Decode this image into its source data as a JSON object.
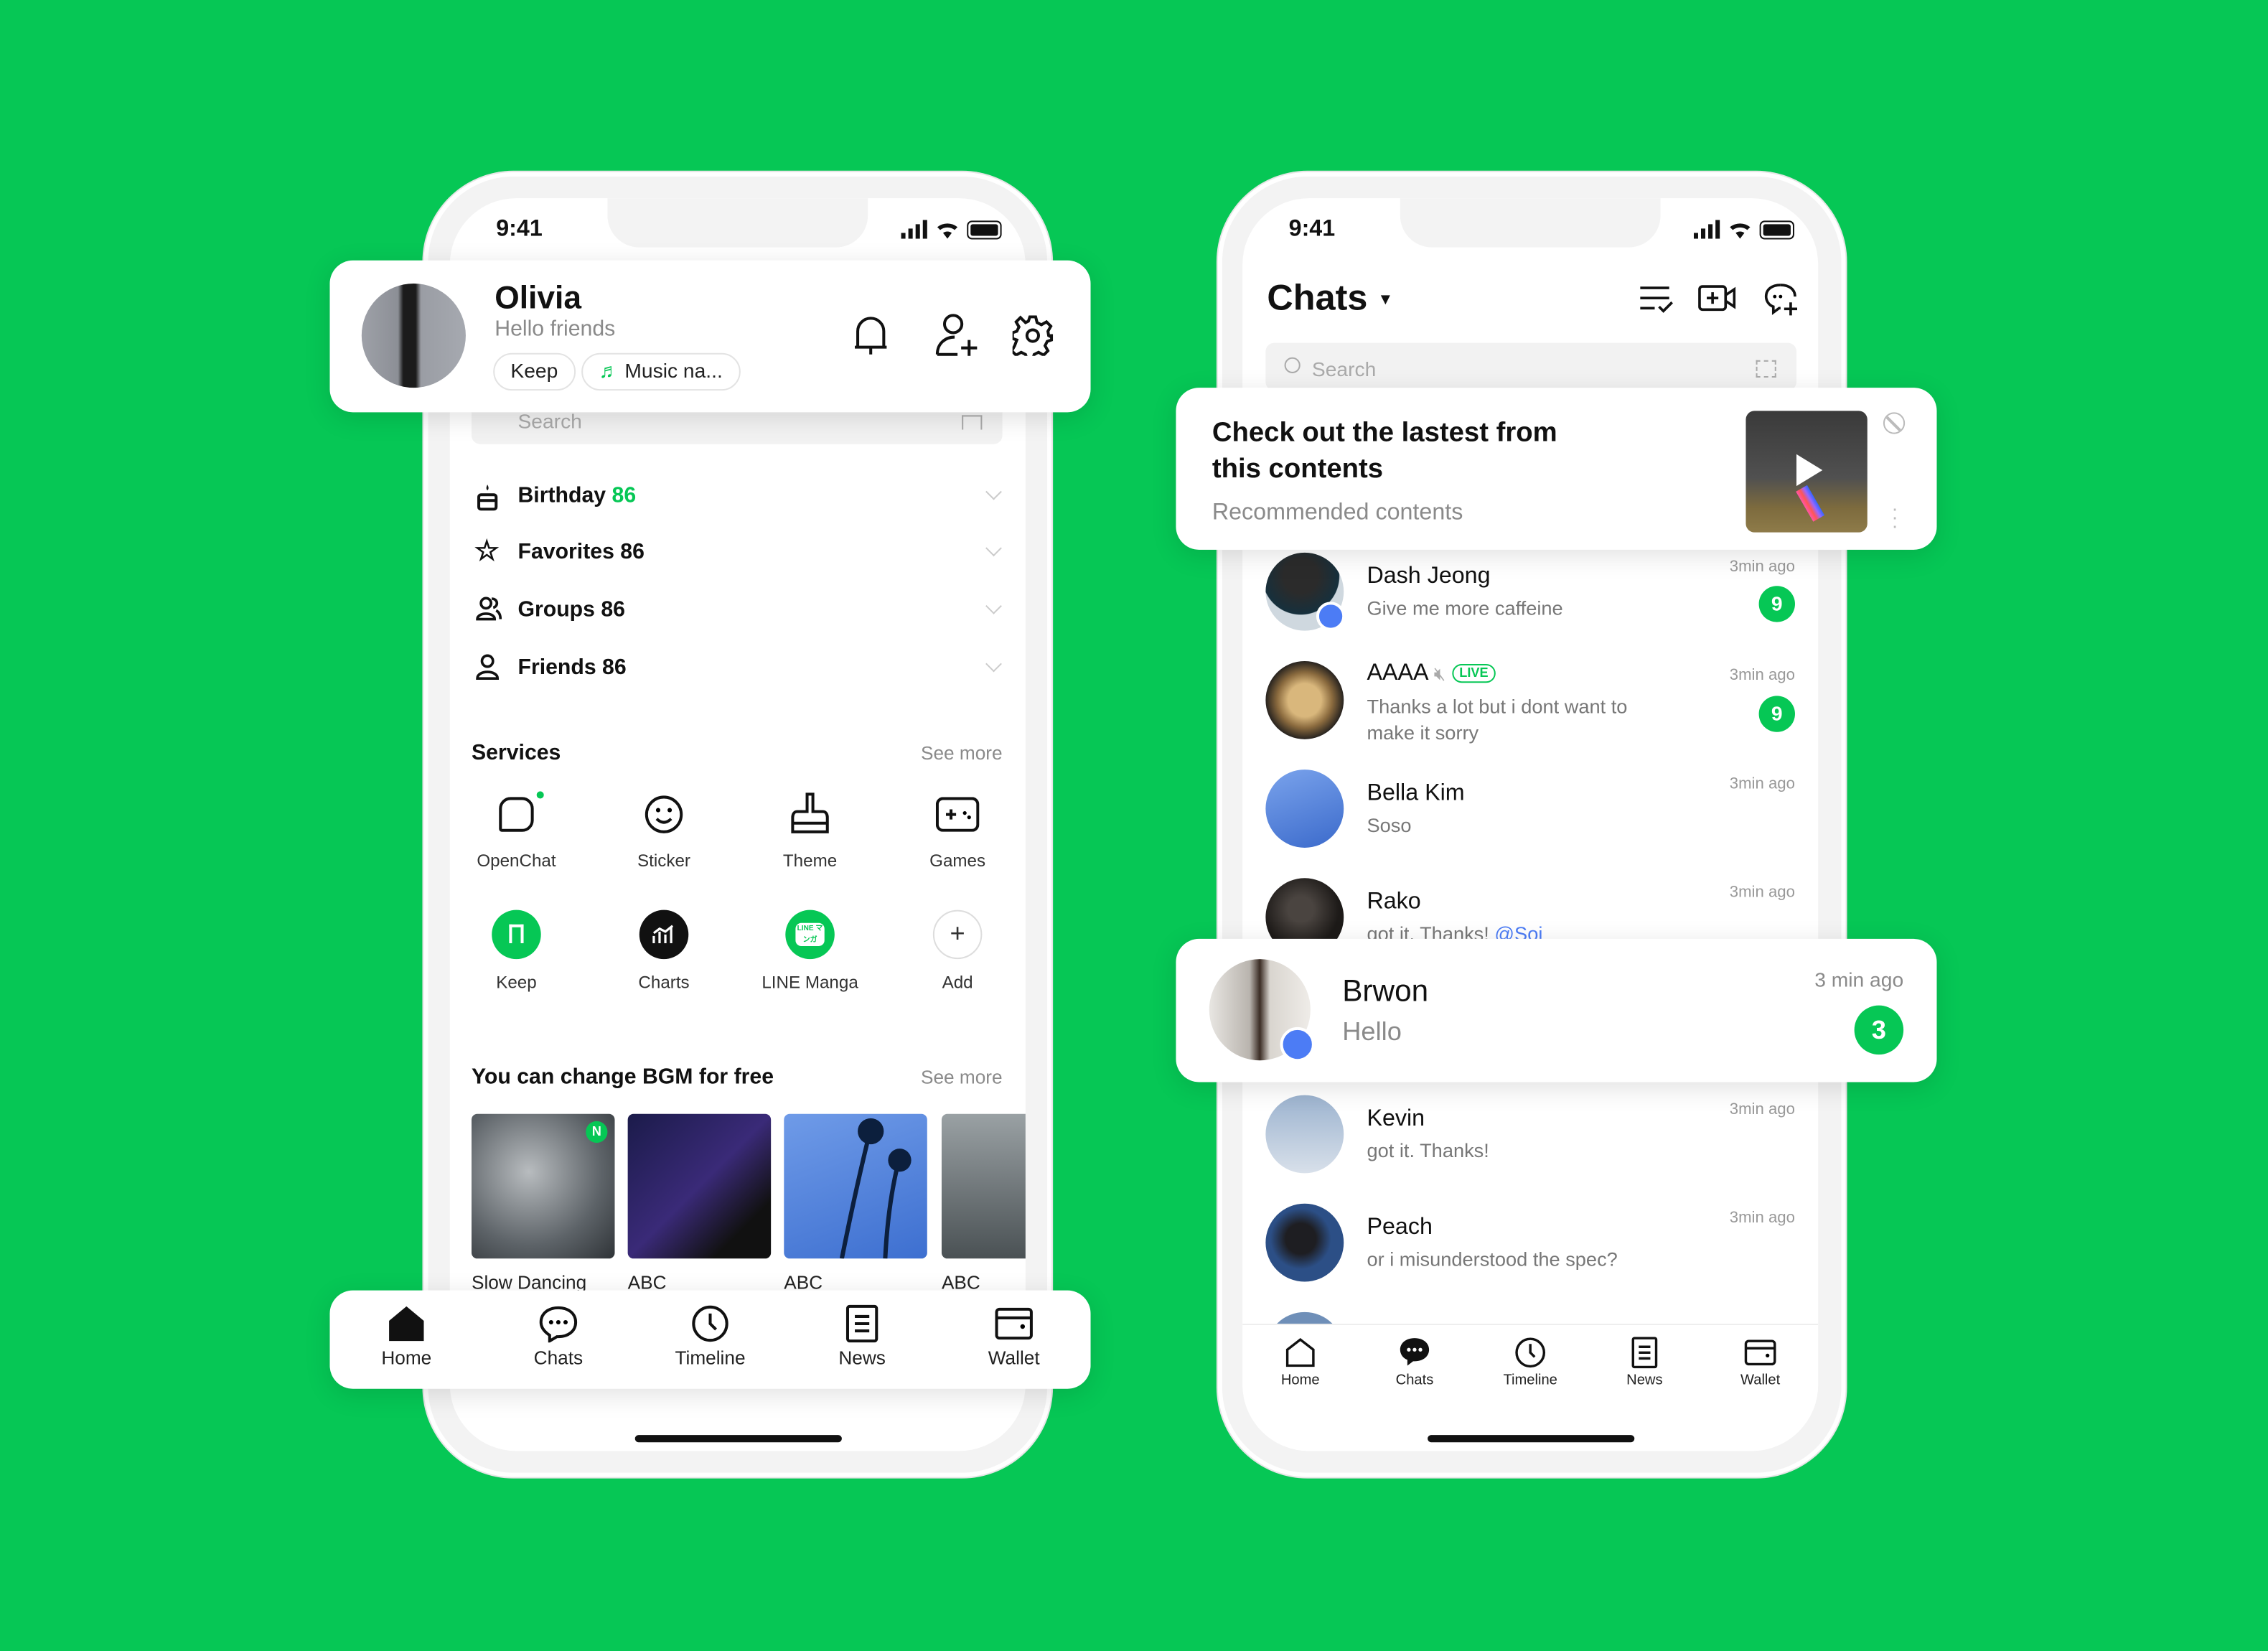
{
  "colors": {
    "background": "#06C755",
    "accent": "#06C755",
    "pin": "#4C7CF5",
    "mention": "#4C7CF5"
  },
  "home_phone": {
    "status_time": "9:41",
    "profile": {
      "name": "Olivia",
      "status": "Hello friends",
      "chips": [
        "Keep",
        "Music na..."
      ],
      "icons": [
        "bell-icon",
        "add-friend-icon",
        "gear-icon"
      ]
    },
    "search_placeholder": "Search",
    "lists": [
      {
        "label": "Birthday",
        "count": "86",
        "icon": "cake-icon"
      },
      {
        "label": "Favorites 86",
        "icon": "star-icon"
      },
      {
        "label": "Groups 86",
        "icon": "group-icon"
      },
      {
        "label": "Friends 86",
        "icon": "person-icon"
      }
    ],
    "services": {
      "title": "Services",
      "see_more": "See more",
      "items": [
        {
          "label": "OpenChat"
        },
        {
          "label": "Sticker"
        },
        {
          "label": "Theme"
        },
        {
          "label": "Games"
        },
        {
          "label": "Keep"
        },
        {
          "label": "Charts"
        },
        {
          "label": "LINE Manga",
          "icon_text": "LINE マンガ"
        },
        {
          "label": "Add"
        }
      ]
    },
    "bgm": {
      "title": "You can change BGM for free",
      "see_more": "See more",
      "new_badge": "N",
      "items": [
        {
          "label": "Slow Dancing"
        },
        {
          "label": "ABC"
        },
        {
          "label": "ABC"
        },
        {
          "label": "ABC"
        }
      ]
    },
    "nav": [
      {
        "label": "Home",
        "active": true
      },
      {
        "label": "Chats"
      },
      {
        "label": "Timeline"
      },
      {
        "label": "News"
      },
      {
        "label": "Wallet"
      }
    ]
  },
  "chats_phone": {
    "status_time": "9:41",
    "title": "Chats",
    "search_placeholder": "Search",
    "recommend": {
      "title_line1": "Check out the lastest from",
      "title_line2": "this contents",
      "subtitle": "Recommended contents"
    },
    "chats": [
      {
        "name": "Dash Jeong",
        "message": "Give me more caffeine",
        "time": "3min ago",
        "unread": "9",
        "pinned": true
      },
      {
        "name": "AAAA",
        "live": "LIVE",
        "muted": true,
        "message_line1": "Thanks a lot but i dont want to",
        "message_line2": "make it sorry",
        "time": "3min ago",
        "unread": "9"
      },
      {
        "name": "Bella Kim",
        "message": "Soso",
        "time": "3min ago"
      },
      {
        "name": "Rako",
        "message": "got it. Thanks!",
        "mention": "@Soi",
        "time": "3min ago"
      },
      {
        "name": "Kevin",
        "message": "got it. Thanks!",
        "time": "3min ago"
      },
      {
        "name": "Peach",
        "message": "or i misunderstood the spec?",
        "time": "3min ago"
      }
    ],
    "featured_chat": {
      "name": "Brwon",
      "message": "Hello",
      "time": "3 min ago",
      "unread": "3",
      "pinned": true
    },
    "nav": [
      {
        "label": "Home"
      },
      {
        "label": "Chats",
        "active": true
      },
      {
        "label": "Timeline"
      },
      {
        "label": "News"
      },
      {
        "label": "Wallet"
      }
    ]
  }
}
